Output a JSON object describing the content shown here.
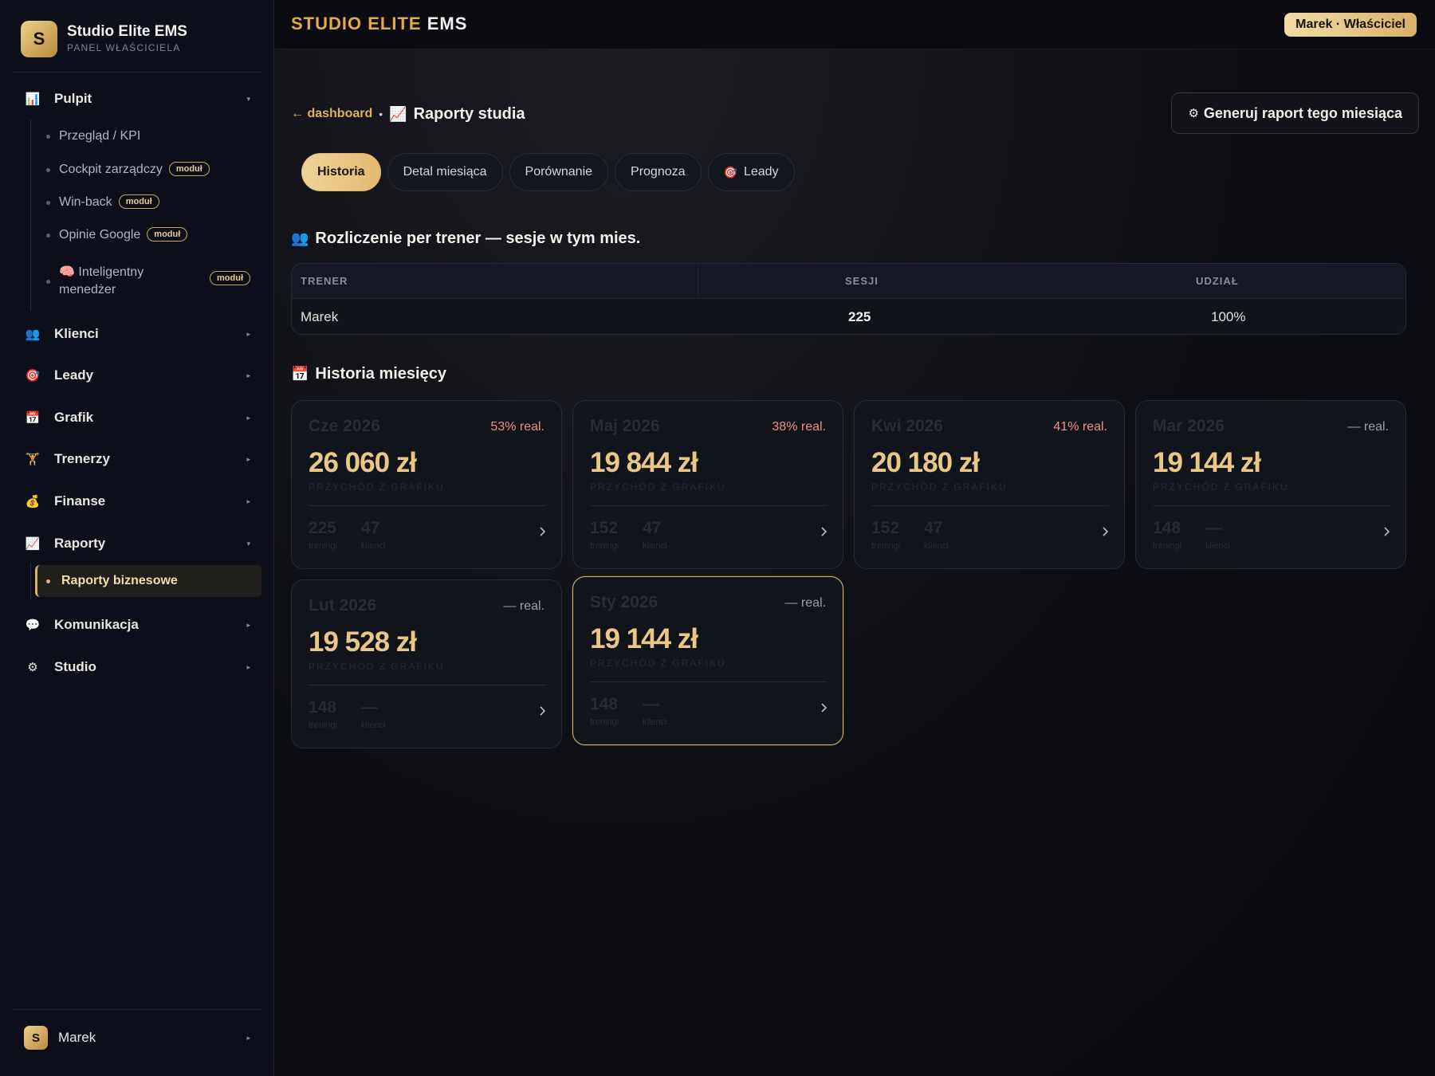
{
  "brand": {
    "logo_letter": "S",
    "name": "Studio Elite EMS",
    "sub": "PANEL WŁAŚCICIELA"
  },
  "nav": {
    "pulpit": {
      "icon": "📊",
      "label": "Pulpit"
    },
    "pulpit_sub": [
      {
        "label": "Przegląd / KPI",
        "badge": ""
      },
      {
        "label": "Cockpit zarządczy",
        "badge": "moduł"
      },
      {
        "label": "Win-back",
        "badge": "moduł"
      },
      {
        "label": "Opinie Google",
        "badge": "moduł"
      },
      {
        "label": "🧠 Inteligentny menedżer",
        "badge": "moduł"
      }
    ],
    "klienci": {
      "icon": "👥",
      "label": "Klienci"
    },
    "leady": {
      "icon": "🎯",
      "label": "Leady"
    },
    "grafik": {
      "icon": "📅",
      "label": "Grafik"
    },
    "trenerzy": {
      "icon": "🏋",
      "label": "Trenerzy"
    },
    "finanse": {
      "icon": "💰",
      "label": "Finanse"
    },
    "raporty": {
      "icon": "📈",
      "label": "Raporty"
    },
    "raporty_sub": [
      {
        "label": "Raporty biznesowe"
      }
    ],
    "komunikacja": {
      "icon": "💬",
      "label": "Komunikacja"
    },
    "studio": {
      "icon": "⚙",
      "label": "Studio"
    }
  },
  "user": {
    "avatar_letter": "S",
    "name": "Marek"
  },
  "topbar": {
    "title_accent": "STUDIO ELITE",
    "title_rest": "EMS",
    "role": "Marek · Właściciel"
  },
  "page": {
    "back_link": "← dashboard",
    "separator": "•",
    "title_icon": "📈",
    "title": "Raporty studia",
    "generate_button": "Generuj raport tego miesiąca",
    "generate_icon": "⚙"
  },
  "tabs": [
    {
      "label": "Historia",
      "icon": ""
    },
    {
      "label": "Detal miesiąca",
      "icon": ""
    },
    {
      "label": "Porównanie",
      "icon": ""
    },
    {
      "label": "Prognoza",
      "icon": ""
    },
    {
      "label": "Leady",
      "icon": "🎯"
    }
  ],
  "trainer_section": {
    "icon": "👥",
    "title": "Rozliczenie per trener — sesje w tym mies.",
    "columns": [
      "TRENER",
      "SESJI",
      "UDZIAŁ"
    ],
    "rows": [
      {
        "trainer": "Marek",
        "sessions": "225",
        "share": "100%"
      }
    ]
  },
  "history_section": {
    "icon": "📅",
    "title": "Historia miesięcy",
    "cards": [
      {
        "month": "Cze 2026",
        "real": "53% real.",
        "value": "26 060 zł",
        "sub": "PRZYCHÓD Z GRAFIKU",
        "trainings": "225",
        "trainings_label": "treningi",
        "clients": "47",
        "clients_label": "klienci"
      },
      {
        "month": "Maj 2026",
        "real": "38% real.",
        "value": "19 844 zł",
        "sub": "PRZYCHÓD Z GRAFIKU",
        "trainings": "152",
        "trainings_label": "treningi",
        "clients": "47",
        "clients_label": "klienci"
      },
      {
        "month": "Kwi 2026",
        "real": "41% real.",
        "value": "20 180 zł",
        "sub": "PRZYCHÓD Z GRAFIKU",
        "trainings": "152",
        "trainings_label": "treningi",
        "clients": "47",
        "clients_label": "klienci"
      },
      {
        "month": "Mar 2026",
        "real": "— real.",
        "value": "19 144 zł",
        "sub": "PRZYCHÓD Z GRAFIKU",
        "trainings": "148",
        "trainings_label": "treningi",
        "clients": "—",
        "clients_label": "klienci"
      },
      {
        "month": "Lut 2026",
        "real": "— real.",
        "value": "19 528 zł",
        "sub": "PRZYCHÓD Z GRAFIKU",
        "trainings": "148",
        "trainings_label": "treningi",
        "clients": "—",
        "clients_label": "klienci"
      },
      {
        "month": "Sty 2026",
        "real": "— real.",
        "value": "19 144 zł",
        "sub": "PRZYCHÓD Z GRAFIKU",
        "trainings": "148",
        "trainings_label": "treningi",
        "clients": "—",
        "clients_label": "klienci"
      }
    ]
  },
  "colors": {
    "accent": "#e6a948",
    "gold": "#e9c887",
    "real_warn": "#ee8f86",
    "background": "#0a0b10"
  }
}
